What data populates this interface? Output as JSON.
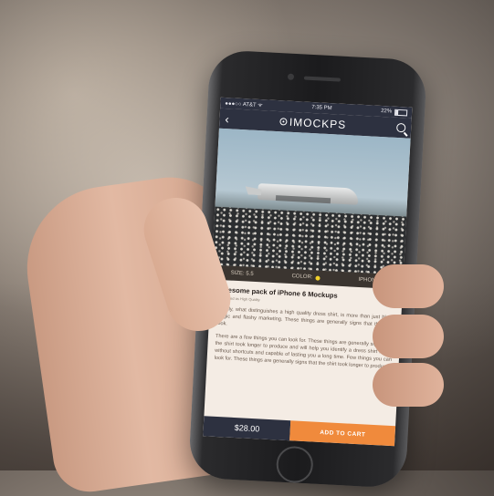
{
  "status_bar": {
    "carrier": "●●●○○ AT&T ᯤ",
    "time": "7:35 PM",
    "battery": "22%",
    "battery_level": 0.22
  },
  "nav": {
    "back_icon": "chevron-left-icon",
    "brand": "IMOCKPS",
    "search_icon": "search-icon"
  },
  "options": {
    "size": "SIZE: 5.5",
    "color": "COLOR:",
    "color_value": "#f2d12a",
    "model": "IPHONE 6"
  },
  "product": {
    "title": "Awesome pack of iPhone 6 Mockups",
    "subtitle": "Marked as High Quality",
    "paragraphs": [
      "Luckily, what distinguishes a high quality dress shirt, is more than just black magic and flashy marketing. These things are generally signs that the shirt took.",
      "There are a few things you can look for. These things are generally signs that the shirt took longer to produce and will help you identify a dress shirt made without shortcuts and capable of lasting you a long time. Few things you can look for. These things are generally signs that the shirt took longer to produce"
    ]
  },
  "footer": {
    "price": "$28.00",
    "cart_label": "ADD TO CART"
  },
  "colors": {
    "nav_bg": "#2d3140",
    "cart_accent": "#f08a3c"
  }
}
